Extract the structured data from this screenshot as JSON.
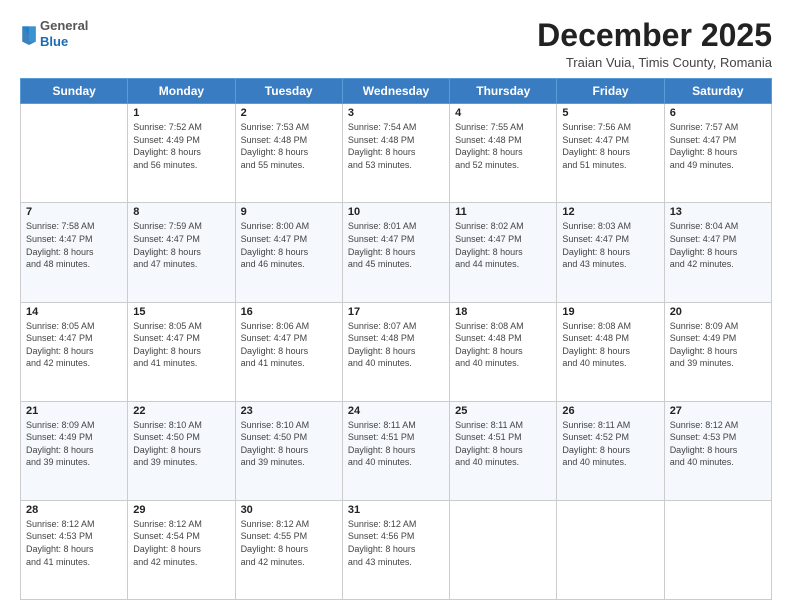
{
  "logo": {
    "general": "General",
    "blue": "Blue"
  },
  "header": {
    "month": "December 2025",
    "location": "Traian Vuia, Timis County, Romania"
  },
  "weekdays": [
    "Sunday",
    "Monday",
    "Tuesday",
    "Wednesday",
    "Thursday",
    "Friday",
    "Saturday"
  ],
  "weeks": [
    [
      {
        "day": "",
        "sunrise": "",
        "sunset": "",
        "daylight": ""
      },
      {
        "day": "1",
        "sunrise": "Sunrise: 7:52 AM",
        "sunset": "Sunset: 4:49 PM",
        "daylight": "Daylight: 8 hours and 56 minutes."
      },
      {
        "day": "2",
        "sunrise": "Sunrise: 7:53 AM",
        "sunset": "Sunset: 4:48 PM",
        "daylight": "Daylight: 8 hours and 55 minutes."
      },
      {
        "day": "3",
        "sunrise": "Sunrise: 7:54 AM",
        "sunset": "Sunset: 4:48 PM",
        "daylight": "Daylight: 8 hours and 53 minutes."
      },
      {
        "day": "4",
        "sunrise": "Sunrise: 7:55 AM",
        "sunset": "Sunset: 4:48 PM",
        "daylight": "Daylight: 8 hours and 52 minutes."
      },
      {
        "day": "5",
        "sunrise": "Sunrise: 7:56 AM",
        "sunset": "Sunset: 4:47 PM",
        "daylight": "Daylight: 8 hours and 51 minutes."
      },
      {
        "day": "6",
        "sunrise": "Sunrise: 7:57 AM",
        "sunset": "Sunset: 4:47 PM",
        "daylight": "Daylight: 8 hours and 49 minutes."
      }
    ],
    [
      {
        "day": "7",
        "sunrise": "Sunrise: 7:58 AM",
        "sunset": "Sunset: 4:47 PM",
        "daylight": "Daylight: 8 hours and 48 minutes."
      },
      {
        "day": "8",
        "sunrise": "Sunrise: 7:59 AM",
        "sunset": "Sunset: 4:47 PM",
        "daylight": "Daylight: 8 hours and 47 minutes."
      },
      {
        "day": "9",
        "sunrise": "Sunrise: 8:00 AM",
        "sunset": "Sunset: 4:47 PM",
        "daylight": "Daylight: 8 hours and 46 minutes."
      },
      {
        "day": "10",
        "sunrise": "Sunrise: 8:01 AM",
        "sunset": "Sunset: 4:47 PM",
        "daylight": "Daylight: 8 hours and 45 minutes."
      },
      {
        "day": "11",
        "sunrise": "Sunrise: 8:02 AM",
        "sunset": "Sunset: 4:47 PM",
        "daylight": "Daylight: 8 hours and 44 minutes."
      },
      {
        "day": "12",
        "sunrise": "Sunrise: 8:03 AM",
        "sunset": "Sunset: 4:47 PM",
        "daylight": "Daylight: 8 hours and 43 minutes."
      },
      {
        "day": "13",
        "sunrise": "Sunrise: 8:04 AM",
        "sunset": "Sunset: 4:47 PM",
        "daylight": "Daylight: 8 hours and 42 minutes."
      }
    ],
    [
      {
        "day": "14",
        "sunrise": "Sunrise: 8:05 AM",
        "sunset": "Sunset: 4:47 PM",
        "daylight": "Daylight: 8 hours and 42 minutes."
      },
      {
        "day": "15",
        "sunrise": "Sunrise: 8:05 AM",
        "sunset": "Sunset: 4:47 PM",
        "daylight": "Daylight: 8 hours and 41 minutes."
      },
      {
        "day": "16",
        "sunrise": "Sunrise: 8:06 AM",
        "sunset": "Sunset: 4:47 PM",
        "daylight": "Daylight: 8 hours and 41 minutes."
      },
      {
        "day": "17",
        "sunrise": "Sunrise: 8:07 AM",
        "sunset": "Sunset: 4:48 PM",
        "daylight": "Daylight: 8 hours and 40 minutes."
      },
      {
        "day": "18",
        "sunrise": "Sunrise: 8:08 AM",
        "sunset": "Sunset: 4:48 PM",
        "daylight": "Daylight: 8 hours and 40 minutes."
      },
      {
        "day": "19",
        "sunrise": "Sunrise: 8:08 AM",
        "sunset": "Sunset: 4:48 PM",
        "daylight": "Daylight: 8 hours and 40 minutes."
      },
      {
        "day": "20",
        "sunrise": "Sunrise: 8:09 AM",
        "sunset": "Sunset: 4:49 PM",
        "daylight": "Daylight: 8 hours and 39 minutes."
      }
    ],
    [
      {
        "day": "21",
        "sunrise": "Sunrise: 8:09 AM",
        "sunset": "Sunset: 4:49 PM",
        "daylight": "Daylight: 8 hours and 39 minutes."
      },
      {
        "day": "22",
        "sunrise": "Sunrise: 8:10 AM",
        "sunset": "Sunset: 4:50 PM",
        "daylight": "Daylight: 8 hours and 39 minutes."
      },
      {
        "day": "23",
        "sunrise": "Sunrise: 8:10 AM",
        "sunset": "Sunset: 4:50 PM",
        "daylight": "Daylight: 8 hours and 39 minutes."
      },
      {
        "day": "24",
        "sunrise": "Sunrise: 8:11 AM",
        "sunset": "Sunset: 4:51 PM",
        "daylight": "Daylight: 8 hours and 40 minutes."
      },
      {
        "day": "25",
        "sunrise": "Sunrise: 8:11 AM",
        "sunset": "Sunset: 4:51 PM",
        "daylight": "Daylight: 8 hours and 40 minutes."
      },
      {
        "day": "26",
        "sunrise": "Sunrise: 8:11 AM",
        "sunset": "Sunset: 4:52 PM",
        "daylight": "Daylight: 8 hours and 40 minutes."
      },
      {
        "day": "27",
        "sunrise": "Sunrise: 8:12 AM",
        "sunset": "Sunset: 4:53 PM",
        "daylight": "Daylight: 8 hours and 40 minutes."
      }
    ],
    [
      {
        "day": "28",
        "sunrise": "Sunrise: 8:12 AM",
        "sunset": "Sunset: 4:53 PM",
        "daylight": "Daylight: 8 hours and 41 minutes."
      },
      {
        "day": "29",
        "sunrise": "Sunrise: 8:12 AM",
        "sunset": "Sunset: 4:54 PM",
        "daylight": "Daylight: 8 hours and 42 minutes."
      },
      {
        "day": "30",
        "sunrise": "Sunrise: 8:12 AM",
        "sunset": "Sunset: 4:55 PM",
        "daylight": "Daylight: 8 hours and 42 minutes."
      },
      {
        "day": "31",
        "sunrise": "Sunrise: 8:12 AM",
        "sunset": "Sunset: 4:56 PM",
        "daylight": "Daylight: 8 hours and 43 minutes."
      },
      {
        "day": "",
        "sunrise": "",
        "sunset": "",
        "daylight": ""
      },
      {
        "day": "",
        "sunrise": "",
        "sunset": "",
        "daylight": ""
      },
      {
        "day": "",
        "sunrise": "",
        "sunset": "",
        "daylight": ""
      }
    ]
  ]
}
